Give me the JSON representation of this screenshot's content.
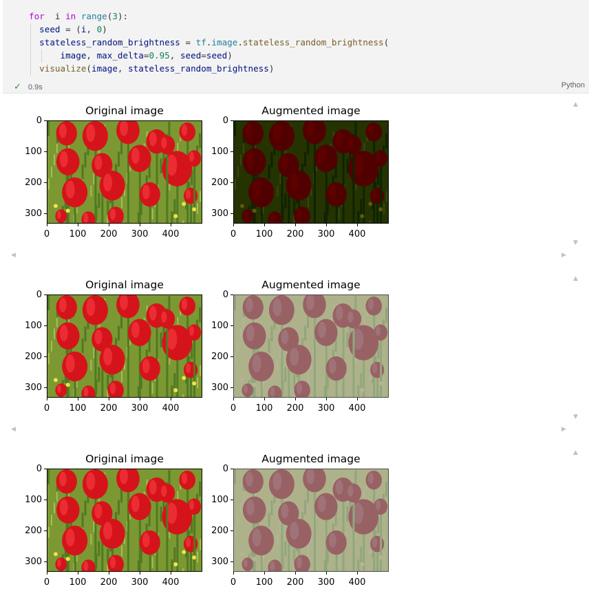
{
  "cell": {
    "code_lines": [
      [
        [
          "kw",
          "for"
        ],
        [
          "",
          "  i "
        ],
        [
          "kw",
          "in"
        ],
        [
          "",
          ""
        ],
        [
          "fb",
          " range"
        ],
        [
          "",
          "("
        ],
        [
          "nm",
          "3"
        ],
        [
          "",
          "):"
        ]
      ],
      [
        [
          "vr",
          "  seed"
        ],
        [
          "",
          " = ("
        ],
        [
          "vr",
          "i"
        ],
        [
          "",
          ", "
        ],
        [
          "nm",
          "0"
        ],
        [
          "",
          ")"
        ]
      ],
      [
        [
          "vr",
          "  stateless_random_brightness"
        ],
        [
          "",
          " = "
        ],
        [
          "mod",
          "tf"
        ],
        [
          "",
          "."
        ],
        [
          "mod",
          "image"
        ],
        [
          "",
          "."
        ],
        [
          "fn",
          "stateless_random_brightness"
        ],
        [
          "",
          "("
        ]
      ],
      [
        [
          "",
          "      "
        ],
        [
          "vr",
          "image"
        ],
        [
          "",
          ", "
        ],
        [
          "vr",
          "max_delta"
        ],
        [
          "",
          "="
        ],
        [
          "nm",
          "0.95"
        ],
        [
          "",
          ", "
        ],
        [
          "vr",
          "seed"
        ],
        [
          "",
          "="
        ],
        [
          "vr",
          "seed"
        ],
        [
          "",
          ")"
        ]
      ],
      [
        [
          "fn",
          "  visualize"
        ],
        [
          "",
          "("
        ],
        [
          "vr",
          "image"
        ],
        [
          "",
          ", "
        ],
        [
          "vr",
          "stateless_random_brightness"
        ],
        [
          "",
          ")"
        ]
      ]
    ],
    "status_icon": "check-icon",
    "exec_time": "0.9s",
    "language": "Python"
  },
  "output": {
    "figures": [
      {
        "original_title": "Original image",
        "augmented_title": "Augmented image",
        "augmented_effect": "darker"
      },
      {
        "original_title": "Original image",
        "augmented_title": "Augmented image",
        "augmented_effect": "brighter"
      },
      {
        "original_title": "Original image",
        "augmented_title": "Augmented image",
        "augmented_effect": "brighter"
      }
    ],
    "y_ticks": [
      "0",
      "100",
      "200",
      "300"
    ],
    "x_ticks": [
      "0",
      "100",
      "200",
      "300",
      "400"
    ]
  }
}
